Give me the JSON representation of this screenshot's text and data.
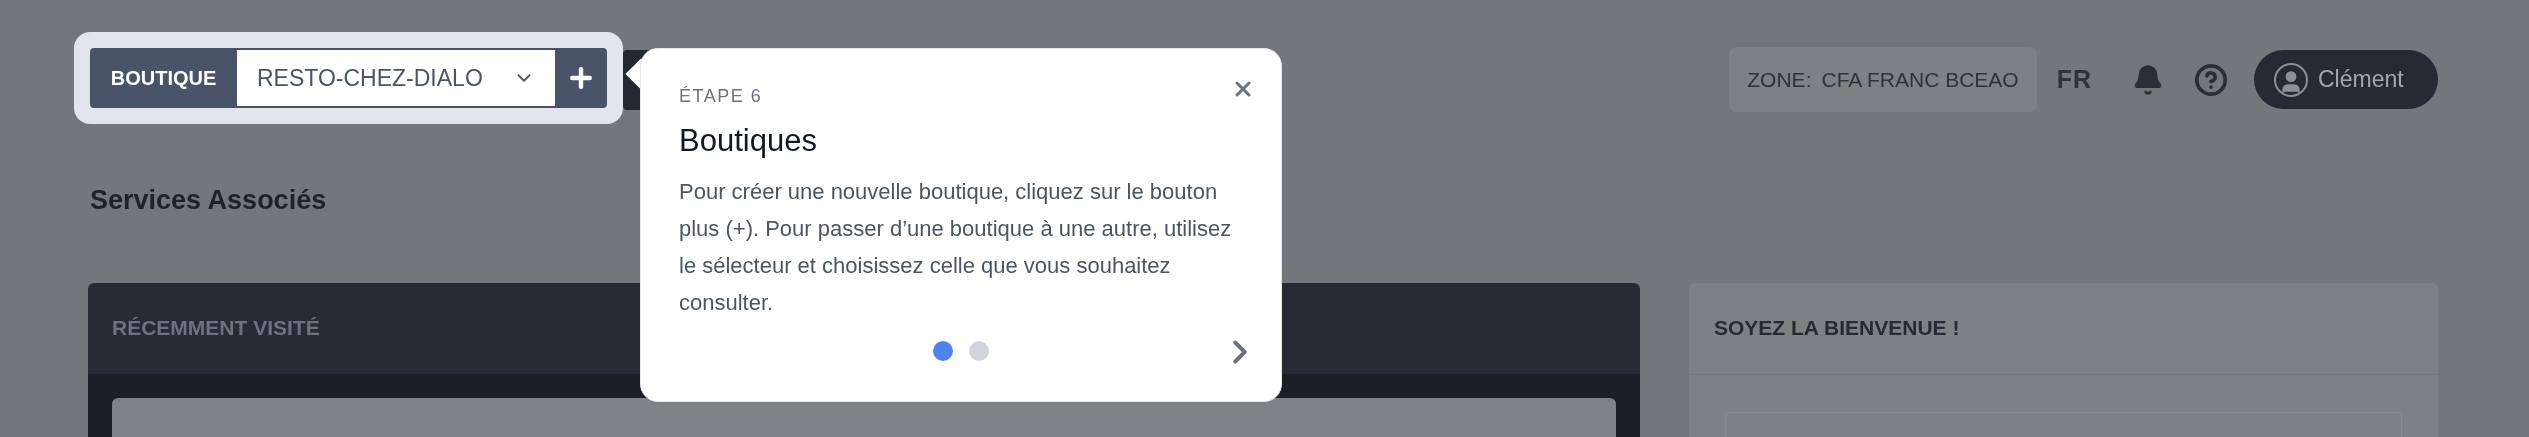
{
  "header": {
    "shop_selector": {
      "label": "BOUTIQUE",
      "value": "RESTO-CHEZ-DIALO"
    },
    "zone": {
      "label": "ZONE:",
      "value": "CFA FRANC BCEAO"
    },
    "language": "FR",
    "user": {
      "name": "Clément"
    }
  },
  "page_title": "Services Associés",
  "recent_panel": {
    "title": "RÉCEMMENT VISITÉ"
  },
  "welcome_card": {
    "title": "SOYEZ LA BIENVENUE !"
  },
  "tour": {
    "step": "ÉTAPE 6",
    "title": "Boutiques",
    "body": "Pour créer une nouvelle boutique, cliquez sur le bouton plus (+). Pour passer d’une boutique à une autre, utilisez le sélecteur et choisissez celle que vous souhaitez consulter.",
    "dots": [
      {
        "selected": true
      },
      {
        "selected": false
      }
    ]
  }
}
